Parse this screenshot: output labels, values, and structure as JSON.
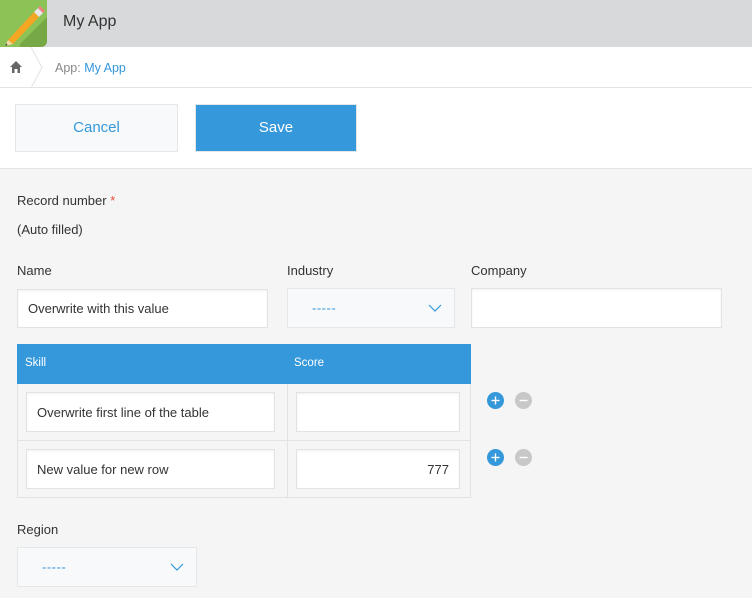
{
  "header": {
    "app_title": "My App",
    "app_icon": "pencil-icon"
  },
  "breadcrumb": {
    "home_icon": "home-icon",
    "prefix": "App: ",
    "link": "My App"
  },
  "toolbar": {
    "cancel_label": "Cancel",
    "save_label": "Save"
  },
  "form": {
    "record_number": {
      "label": "Record number",
      "required_mark": "*",
      "value": "(Auto filled)"
    },
    "name": {
      "label": "Name",
      "value": "Overwrite with this value"
    },
    "industry": {
      "label": "Industry",
      "selected": "-----"
    },
    "company": {
      "label": "Company",
      "value": ""
    },
    "table": {
      "columns": [
        "Skill",
        "Score"
      ],
      "rows": [
        {
          "skill": "Overwrite first line of the table",
          "score": ""
        },
        {
          "skill": "New value for new row",
          "score": "777"
        }
      ]
    },
    "region": {
      "label": "Region",
      "selected": "-----"
    }
  },
  "colors": {
    "accent": "#3498db",
    "app_icon_bg": "#8cc256",
    "required": "#e74c3c"
  }
}
